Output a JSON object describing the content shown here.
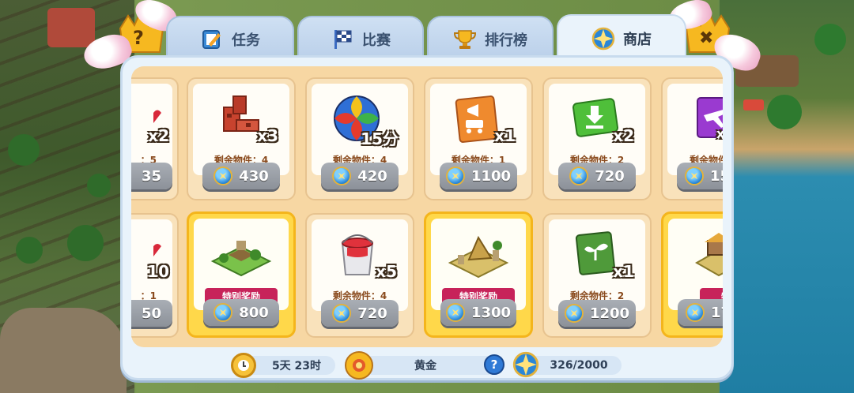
{
  "tabs": [
    {
      "label": "任务",
      "icon": "clipboard-pencil-icon",
      "active": false
    },
    {
      "label": "比赛",
      "icon": "checkered-flag-icon",
      "active": false
    },
    {
      "label": "排行榜",
      "icon": "trophy-icon",
      "active": false
    },
    {
      "label": "商店",
      "icon": "compass-coin-icon",
      "active": true
    }
  ],
  "corner": {
    "help_symbol": "?",
    "close_symbol": "✖"
  },
  "shop": {
    "row1": [
      {
        "partial": true,
        "qty": "x2",
        "remain": "：5",
        "price": "35",
        "icon": "red-heart-icon"
      },
      {
        "qty": "x3",
        "remain": "剩余物件：4",
        "price": "430",
        "icon": "bricks-icon"
      },
      {
        "qty": "15分",
        "remain": "剩余物件：4",
        "price": "420",
        "icon": "colorful-ball-icon"
      },
      {
        "qty": "x1",
        "remain": "剩余物件：1",
        "price": "1100",
        "icon": "megaphone-card-icon"
      },
      {
        "qty": "x2",
        "remain": "剩余物件：2",
        "price": "720",
        "icon": "download-card-icon"
      },
      {
        "partial": true,
        "qty": "x",
        "remain": "剩余物件",
        "price": "15",
        "icon": "plane-card-icon"
      }
    ],
    "row2": [
      {
        "partial": true,
        "qty": "10",
        "remain": "：1",
        "price": "50",
        "icon": "red-heart-icon"
      },
      {
        "special": true,
        "ribbon": "特别奖励",
        "price": "800",
        "icon": "garden-plot-icon"
      },
      {
        "qty": "x5",
        "remain": "剩余物件：4",
        "price": "720",
        "icon": "paint-bucket-icon"
      },
      {
        "special": true,
        "ribbon": "特别奖励",
        "price": "1300",
        "icon": "ruins-plot-icon"
      },
      {
        "qty": "x1",
        "remain": "剩余物件：2",
        "price": "1200",
        "icon": "sprout-card-icon"
      },
      {
        "partial": true,
        "special": true,
        "ribbon": "特别奖",
        "price": "17",
        "icon": "market-plot-icon"
      }
    ]
  },
  "footer": {
    "time_left": "5天 23时",
    "league": "黄金",
    "help_symbol": "?",
    "progress": "326/2000"
  },
  "colors": {
    "ribbon": "#c7235a",
    "special_card": "#ffd84a",
    "card": "#f9e2bb",
    "price_button": "#9a9ea6"
  }
}
